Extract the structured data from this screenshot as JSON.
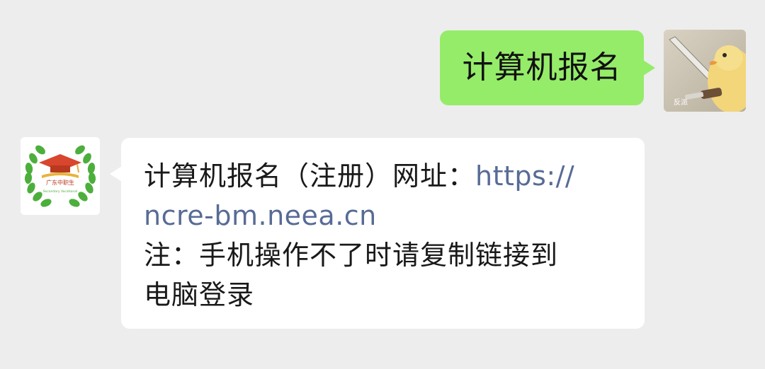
{
  "sent": {
    "text": "计算机报名",
    "avatar_caption": "反派"
  },
  "received": {
    "line1_prefix": "计算机报名（注册）网址：",
    "line1_link": "https://",
    "line2_link": "ncre-bm.neea.cn",
    "line3": "注：手机操作不了时请复制链接到",
    "line4": "电脑登录"
  },
  "avatar_badge": {
    "title": "广东中职生",
    "subtitle": "Secondary Vocational"
  },
  "colors": {
    "background": "#ededed",
    "sent_bubble": "#95ec69",
    "received_bubble": "#ffffff",
    "link": "#576b95",
    "text": "#191919"
  }
}
